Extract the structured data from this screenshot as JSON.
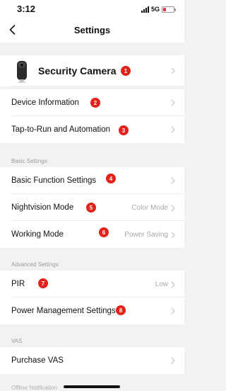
{
  "status_bar": {
    "time": "3:12",
    "network": "5G"
  },
  "nav": {
    "title": "Settings"
  },
  "device": {
    "name": "Security Camera"
  },
  "rows": {
    "device_information": "Device Information",
    "tap_to_run": "Tap-to-Run and Automation",
    "basic_function": "Basic Function Settings",
    "nightvision": {
      "label": "Nightvision Mode",
      "value": "Color Mode"
    },
    "working_mode": {
      "label": "Working Mode",
      "value": "Power Saving"
    },
    "pir": {
      "label": "PIR",
      "value": "Low"
    },
    "power_management": "Power Management Settings",
    "purchase_vas": "Purchase VAS"
  },
  "groups": {
    "basic": "Basic Settings",
    "advanced": "Advanced Settings",
    "vas": "VAS",
    "offline": "Offline Notification"
  },
  "badges": [
    "1",
    "2",
    "3",
    "4",
    "5",
    "6",
    "7",
    "8"
  ],
  "colors": {
    "badge": "#e3221b",
    "battery": "#e8324b"
  }
}
